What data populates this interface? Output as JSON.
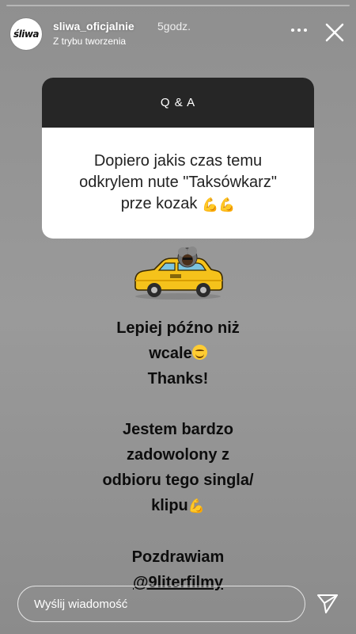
{
  "header": {
    "avatar_text": "śliwa",
    "username": "sliwa_oficjalnie",
    "time": "5godz.",
    "subtitle": "Z trybu tworzenia",
    "progress": 0.0
  },
  "question_sticker": {
    "title": "Q & A",
    "question_line1": "Dopiero jakis czas temu",
    "question_line2": "odkrylem nute \"Taksówkarz\"",
    "question_line3": "prze kozak",
    "question_emoji": "💪",
    "question_emoji_count": 2
  },
  "reply": {
    "line1": "Lepiej późno niż",
    "line2": "wcale",
    "line3": "Thanks!",
    "line4": "Jestem bardzo",
    "line5": "zadowolony z",
    "line6": "odbioru tego singla/",
    "line7": "klipu",
    "line7_emoji": "💪",
    "line8": "Pozdrawiam",
    "mention": "@9literfilmy"
  },
  "footer": {
    "message_placeholder": "Wyślij wiadomość"
  },
  "icons": {
    "more": "more-horizontal-icon",
    "close": "close-icon",
    "send": "send-icon",
    "sticker": "taxi-sticker"
  },
  "colors": {
    "story_bg": "#959595",
    "qa_header_bg": "#262626",
    "card_bg": "#ffffff",
    "text_dark": "#0d0d0d",
    "taxi_yellow": "#f5c21b"
  }
}
